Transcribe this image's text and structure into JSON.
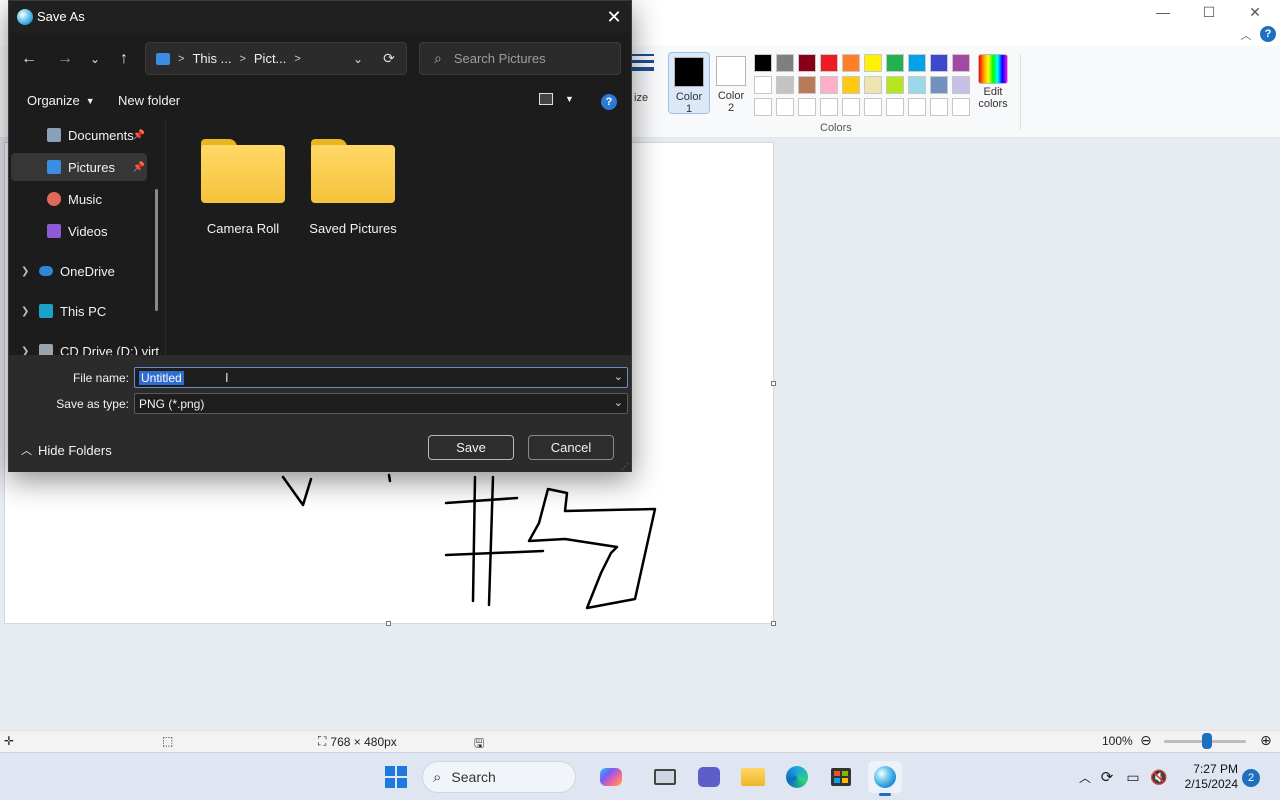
{
  "paint": {
    "window_controls": {
      "minimize": "—",
      "maximize": "☐",
      "close": "✕"
    },
    "ribbon": {
      "size_label": "ize",
      "color1_label": "Color\n1",
      "color2_label": "Color\n2",
      "color1_value": "#000000",
      "color2_value": "#ffffff",
      "colors_group_label": "Colors",
      "edit_colors_label": "Edit\ncolors",
      "palette": [
        "#000000",
        "#7f7f7f",
        "#880015",
        "#ed1c24",
        "#ff7f27",
        "#fff200",
        "#22b14c",
        "#00a2e8",
        "#3f48cc",
        "#a349a4",
        "#ffffff",
        "#c3c3c3",
        "#b97a57",
        "#ffaec9",
        "#ffc90e",
        "#efe4b0",
        "#b5e61d",
        "#99d9ea",
        "#7092be",
        "#c8bfe7",
        "#ffffff",
        "#ffffff",
        "#ffffff",
        "#ffffff",
        "#ffffff",
        "#ffffff",
        "#ffffff",
        "#ffffff",
        "#ffffff",
        "#ffffff"
      ]
    },
    "statusbar": {
      "canvas_size": "768 × 480px",
      "zoom": "100%",
      "zoom_fraction": 0.5
    }
  },
  "dialog": {
    "title": "Save As",
    "address": {
      "segment1": "This ...",
      "segment2": "Pict...",
      "sep": ">"
    },
    "search": {
      "placeholder": "Search Pictures"
    },
    "cmd": {
      "organize": "Organize",
      "new_folder": "New folder",
      "help": "?"
    },
    "nav_items": [
      {
        "label": "Documents",
        "pinned": true
      },
      {
        "label": "Pictures",
        "pinned": true,
        "selected": true
      },
      {
        "label": "Music"
      },
      {
        "label": "Videos"
      },
      {
        "label": "OneDrive",
        "expandable": true
      },
      {
        "label": "This PC",
        "expandable": true
      },
      {
        "label": "CD Drive (D:) virt",
        "expandable": true
      }
    ],
    "folders": [
      {
        "name": "Camera Roll"
      },
      {
        "name": "Saved Pictures"
      }
    ],
    "file_name_label": "File name:",
    "file_name_value": "Untitled",
    "save_type_label": "Save as type:",
    "save_type_value": "PNG (*.png)",
    "hide_folders": "Hide Folders",
    "save_button": "Save",
    "cancel_button": "Cancel"
  },
  "taskbar": {
    "search_label": "Search",
    "time": "7:27 PM",
    "date": "2/15/2024",
    "notification_count": "2"
  }
}
